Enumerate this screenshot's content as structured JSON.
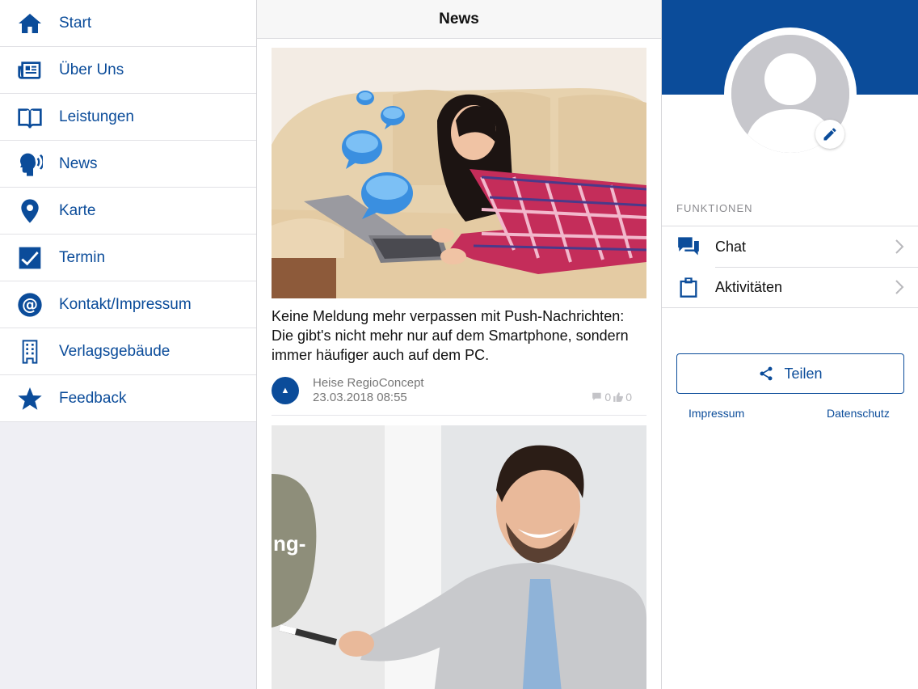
{
  "sidebar": {
    "items": [
      {
        "label": "Start",
        "icon": "home-icon"
      },
      {
        "label": "Über Uns",
        "icon": "newspaper-icon"
      },
      {
        "label": "Leistungen",
        "icon": "book-icon"
      },
      {
        "label": "News",
        "icon": "speaking-head-icon"
      },
      {
        "label": "Karte",
        "icon": "map-pin-icon"
      },
      {
        "label": "Termin",
        "icon": "checkbox-icon"
      },
      {
        "label": "Kontakt/Impressum",
        "icon": "at-sign-icon"
      },
      {
        "label": "Verlagsgebäude",
        "icon": "building-icon"
      },
      {
        "label": "Feedback",
        "icon": "star-icon"
      }
    ]
  },
  "feed": {
    "title": "News",
    "articles": [
      {
        "text": "Keine Meldung mehr verpassen mit Push-Nachrichten: Die gibt's nicht mehr nur auf dem Smartphone, sondern immer häufiger auch auf dem PC.",
        "source": "Heise RegioConcept",
        "date": "23.03.2018 08:55",
        "comments": "0",
        "likes": "0"
      },
      {
        "image_text": "ng-"
      }
    ]
  },
  "right": {
    "section_label": "FUNKTIONEN",
    "functions": [
      {
        "label": "Chat",
        "icon": "chat-icon"
      },
      {
        "label": "Aktivitäten",
        "icon": "clipboard-icon"
      }
    ],
    "share_label": "Teilen",
    "impressum": "Impressum",
    "datenschutz": "Datenschutz"
  },
  "colors": {
    "brand": "#0b4c9a",
    "sidebar_bg": "#efeff4"
  }
}
